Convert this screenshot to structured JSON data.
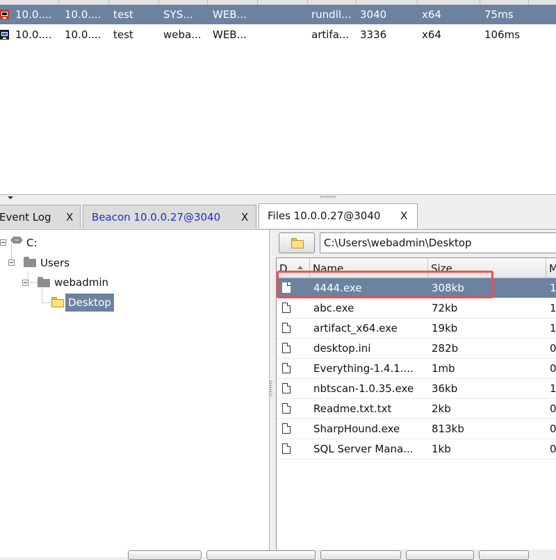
{
  "beacons": {
    "rows": [
      {
        "external": "10.0....",
        "internal": "10.0....",
        "user": "test",
        "computer": "SYS...",
        "host": "WEB...",
        "process": "rundll...",
        "pid": "3040",
        "arch": "x64",
        "last": "75ms",
        "selected": true
      },
      {
        "external": "10.0....",
        "internal": "10.0....",
        "user": "test",
        "computer": "weba...",
        "host": "WEB...",
        "process": "artifa...",
        "pid": "3336",
        "arch": "x64",
        "last": "106ms",
        "selected": false
      }
    ]
  },
  "tabs": [
    {
      "label": "Event Log",
      "close": "X"
    },
    {
      "label": "Beacon 10.0.0.27@3040",
      "close": "X"
    },
    {
      "label": "Files 10.0.0.27@3040",
      "close": "X",
      "active": true
    }
  ],
  "tree": {
    "drive": "C:",
    "users": "Users",
    "webadmin": "webadmin",
    "desktop": "Desktop"
  },
  "files": {
    "path": "C:\\Users\\webadmin\\Desktop",
    "columns": {
      "d": "D",
      "name": "Name",
      "size": "Size",
      "modified": "M"
    },
    "rows": [
      {
        "name": "4444.exe",
        "size": "308kb",
        "mod": "1",
        "selected": true
      },
      {
        "name": "abc.exe",
        "size": "72kb",
        "mod": "1"
      },
      {
        "name": "artifact_x64.exe",
        "size": "19kb",
        "mod": "1"
      },
      {
        "name": "desktop.ini",
        "size": "282b",
        "mod": "0"
      },
      {
        "name": "Everything-1.4.1....",
        "size": "1mb",
        "mod": "0"
      },
      {
        "name": "nbtscan-1.0.35.exe",
        "size": "36kb",
        "mod": "1"
      },
      {
        "name": "Readme.txt.txt",
        "size": "2kb",
        "mod": "0"
      },
      {
        "name": "SharpHound.exe",
        "size": "813kb",
        "mod": "0"
      },
      {
        "name": "SQL Server Mana...",
        "size": "1kb",
        "mod": "0"
      }
    ]
  },
  "colors": {
    "selection": "#6b83a1",
    "highlight": "#ec5050",
    "tab_blue": "#1f2fb8"
  }
}
